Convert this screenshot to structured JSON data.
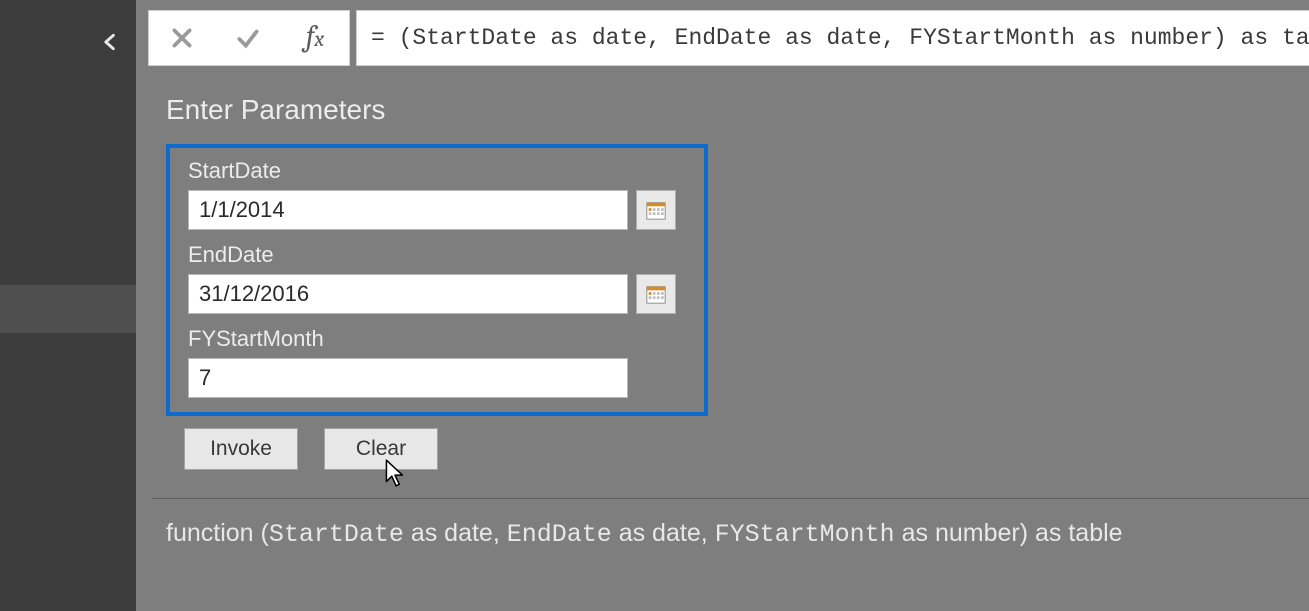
{
  "formula_bar": {
    "expression": "= (StartDate as date, EndDate as date, FYStartMonth as number) as table"
  },
  "page": {
    "title": "Enter Parameters"
  },
  "params": {
    "start_date": {
      "label": "StartDate",
      "value": "1/1/2014"
    },
    "end_date": {
      "label": "EndDate",
      "value": "31/12/2016"
    },
    "fy_start_month": {
      "label": "FYStartMonth",
      "value": "7"
    }
  },
  "buttons": {
    "invoke": "Invoke",
    "clear": "Clear"
  },
  "signature": {
    "prefix": "function (",
    "p1_name": "StartDate",
    "p1_rest": " as date, ",
    "p2_name": "EndDate",
    "p2_rest": " as date, ",
    "p3_name": "FYStartMonth",
    "p3_rest": " as number) as table"
  }
}
